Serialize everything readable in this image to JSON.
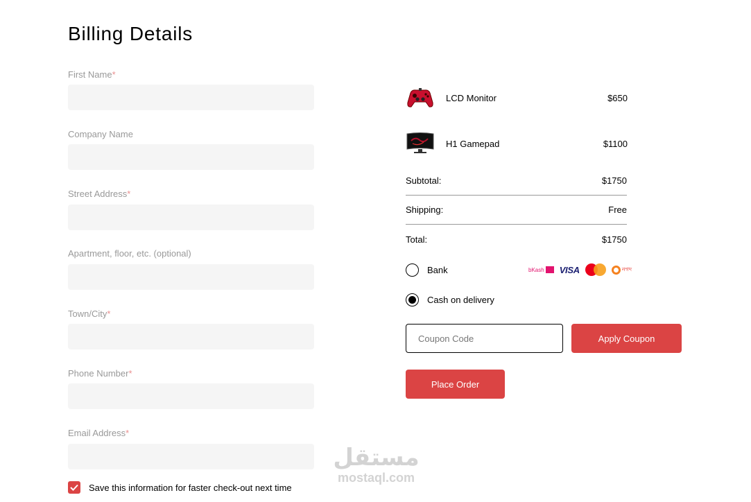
{
  "page_title": "Billing Details",
  "form": {
    "fields": [
      {
        "label": "First Name",
        "required": true,
        "value": ""
      },
      {
        "label": "Company Name",
        "required": false,
        "value": ""
      },
      {
        "label": "Street Address",
        "required": true,
        "value": ""
      },
      {
        "label": "Apartment, floor, etc. (optional)",
        "required": false,
        "value": ""
      },
      {
        "label": "Town/City",
        "required": true,
        "value": ""
      },
      {
        "label": "Phone Number",
        "required": true,
        "value": ""
      },
      {
        "label": "Email Address",
        "required": true,
        "value": ""
      }
    ],
    "required_mark": "*",
    "save_info": {
      "label": "Save this information for faster check-out next time",
      "checked": true
    }
  },
  "order": {
    "products": [
      {
        "name": "LCD Monitor",
        "price": "$650",
        "icon": "gamepad-icon"
      },
      {
        "name": "H1 Gamepad",
        "price": "$1100",
        "icon": "monitor-icon"
      }
    ],
    "subtotal": {
      "label": "Subtotal:",
      "value": "$1750"
    },
    "shipping": {
      "label": "Shipping:",
      "value": "Free"
    },
    "total": {
      "label": "Total:",
      "value": "$1750"
    }
  },
  "payment": {
    "options": [
      {
        "label": "Bank",
        "selected": false
      },
      {
        "label": "Cash on delivery",
        "selected": true
      }
    ],
    "logos": {
      "bkash": "bKash",
      "visa": "VISA",
      "mastercard": "mastercard",
      "nagad": "নগদ"
    }
  },
  "coupon": {
    "placeholder": "Coupon Code",
    "value": "",
    "apply_label": "Apply Coupon"
  },
  "place_order_label": "Place Order",
  "watermark": {
    "arabic": "مستقل",
    "latin": "mostaql.com"
  },
  "colors": {
    "accent": "#DB4444",
    "input_bg": "#F5F5F5",
    "label_gray": "#999999"
  }
}
